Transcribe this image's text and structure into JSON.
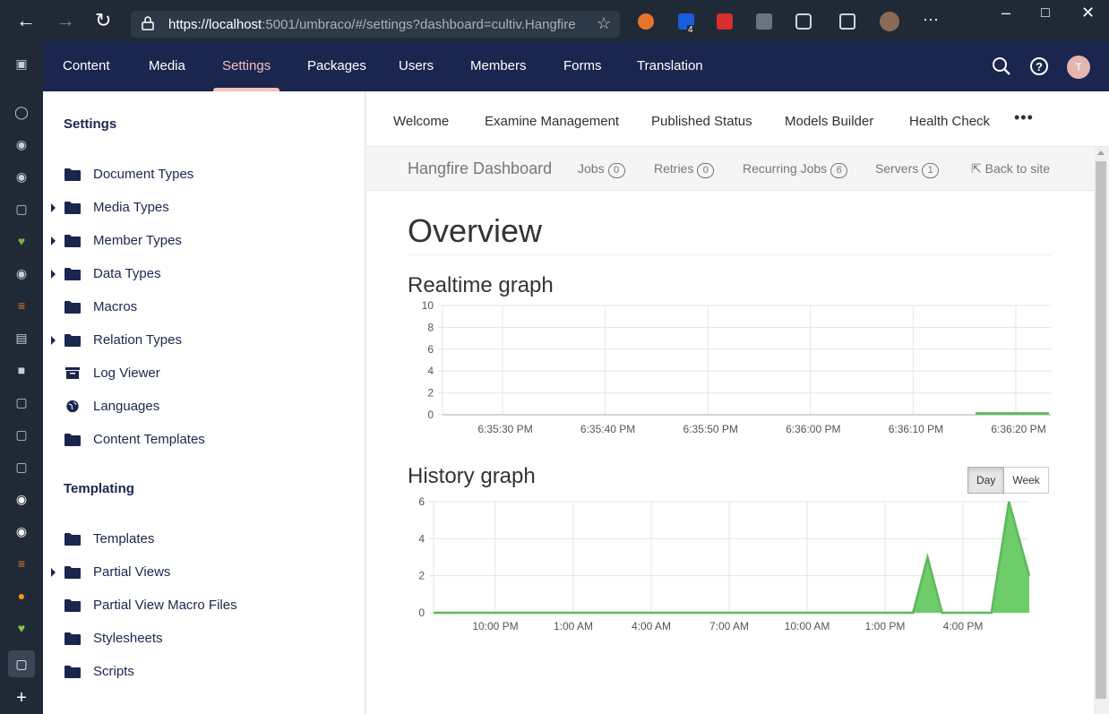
{
  "browser": {
    "url_host": "https://localhost",
    "url_path": ":5001/umbraco/#/settings?dashboard=cultiv.Hangfire",
    "extension_badge": "4"
  },
  "topnav": {
    "items": [
      "Content",
      "Media",
      "Settings",
      "Packages",
      "Users",
      "Members",
      "Forms",
      "Translation"
    ],
    "active": "Settings",
    "avatar_initial": "T"
  },
  "tree": {
    "settings_heading": "Settings",
    "settings_items": [
      {
        "label": "Document Types",
        "expandable": false,
        "icon": "folder-icon"
      },
      {
        "label": "Media Types",
        "expandable": true,
        "icon": "folder-icon"
      },
      {
        "label": "Member Types",
        "expandable": true,
        "icon": "folder-icon"
      },
      {
        "label": "Data Types",
        "expandable": true,
        "icon": "folder-icon"
      },
      {
        "label": "Macros",
        "expandable": false,
        "icon": "folder-icon"
      },
      {
        "label": "Relation Types",
        "expandable": true,
        "icon": "folder-icon"
      },
      {
        "label": "Log Viewer",
        "expandable": false,
        "icon": "box-icon"
      },
      {
        "label": "Languages",
        "expandable": false,
        "icon": "globe-icon"
      },
      {
        "label": "Content Templates",
        "expandable": false,
        "icon": "folder-icon"
      }
    ],
    "templating_heading": "Templating",
    "templating_items": [
      {
        "label": "Templates",
        "expandable": false,
        "icon": "folder-icon"
      },
      {
        "label": "Partial Views",
        "expandable": true,
        "icon": "folder-icon"
      },
      {
        "label": "Partial View Macro Files",
        "expandable": false,
        "icon": "folder-icon"
      },
      {
        "label": "Stylesheets",
        "expandable": false,
        "icon": "folder-icon"
      },
      {
        "label": "Scripts",
        "expandable": false,
        "icon": "folder-icon"
      }
    ]
  },
  "dashboard_tabs": [
    "Welcome",
    "Examine Management",
    "Published Status",
    "Models Builder",
    "Health Check"
  ],
  "more_label": "•••",
  "hangfire": {
    "brand": "Hangfire Dashboard",
    "jobs_label": "Jobs",
    "jobs_count": "0",
    "retries_label": "Retries",
    "retries_count": "0",
    "recurring_label": "Recurring Jobs",
    "recurring_count": "6",
    "servers_label": "Servers",
    "servers_count": "1",
    "back_label": "Back to site",
    "overview_title": "Overview",
    "realtime_title": "Realtime graph",
    "history_title": "History graph",
    "day_label": "Day",
    "week_label": "Week"
  },
  "colors": {
    "topnav": "#1b264f",
    "active": "#f5c1bc",
    "graph_fill": "#6fcc6b",
    "graph_line": "#5cb85c"
  },
  "chart_data": [
    {
      "type": "area",
      "title": "Realtime graph",
      "x": [
        "6:35:30 PM",
        "6:35:40 PM",
        "6:35:50 PM",
        "6:36:00 PM",
        "6:36:10 PM",
        "6:36:20 PM"
      ],
      "ylim": [
        0,
        10
      ],
      "yticks": [
        0,
        2,
        4,
        6,
        8,
        10
      ],
      "series": [
        {
          "values": [
            0,
            0,
            0,
            0,
            0,
            0
          ]
        }
      ],
      "grid": true
    },
    {
      "type": "area",
      "title": "History graph",
      "x": [
        "10:00 PM",
        "1:00 AM",
        "4:00 AM",
        "7:00 AM",
        "10:00 AM",
        "1:00 PM",
        "4:00 PM"
      ],
      "ylim": [
        0,
        6
      ],
      "yticks": [
        0,
        2,
        4,
        6
      ],
      "series": [
        {
          "points": [
            [
              0,
              0
            ],
            [
              16.5,
              0
            ],
            [
              17,
              3
            ],
            [
              17.5,
              0
            ],
            [
              19.2,
              0
            ],
            [
              19.8,
              6
            ],
            [
              20.5,
              2
            ]
          ]
        }
      ],
      "grid": true
    }
  ]
}
